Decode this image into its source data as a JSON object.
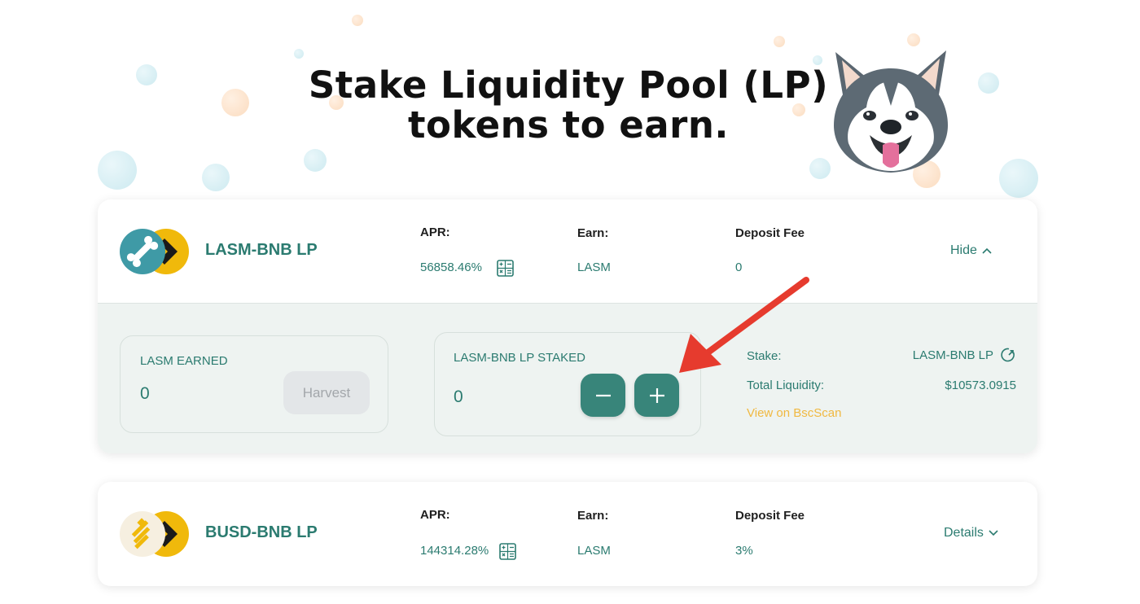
{
  "colors": {
    "accent": "#2b7b70",
    "button": "#38857a",
    "link_yellow": "#f0b840",
    "arrow": "#e63b2e"
  },
  "hero": {
    "line1": "Stake Liquidity Pool (LP)",
    "line2": "tokens to earn."
  },
  "farms": [
    {
      "pair": "LASM-BNB LP",
      "apr_label": "APR:",
      "apr_value": "56858.46%",
      "earn_label": "Earn:",
      "earn_value": "LASM",
      "fee_label": "Deposit Fee",
      "fee_value": "0",
      "toggle_label": "Hide",
      "earned": {
        "title": "LASM EARNED",
        "value": "0",
        "harvest_label": "Harvest"
      },
      "staked": {
        "title": "LASM-BNB LP STAKED",
        "value": "0"
      },
      "details": {
        "stake_label": "Stake:",
        "stake_value": "LASM-BNB LP",
        "liquidity_label": "Total Liquidity:",
        "liquidity_value": "$10573.0915",
        "bscscan_label": "View on BscScan"
      }
    },
    {
      "pair": "BUSD-BNB LP",
      "apr_label": "APR:",
      "apr_value": "144314.28%",
      "earn_label": "Earn:",
      "earn_value": "LASM",
      "fee_label": "Deposit Fee",
      "fee_value": "3%",
      "toggle_label": "Details"
    }
  ]
}
